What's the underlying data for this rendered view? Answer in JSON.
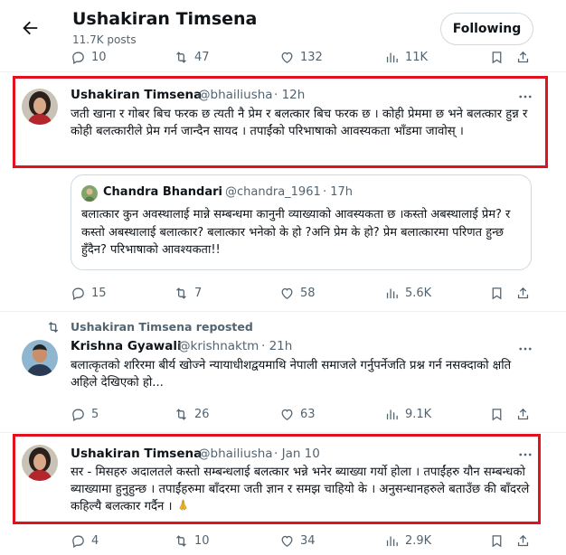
{
  "header": {
    "title": "Ushakiran Timsena",
    "post_count": "11.7K posts",
    "follow_button": "Following"
  },
  "top_actions": {
    "replies": "10",
    "reposts": "47",
    "likes": "132",
    "views": "11K"
  },
  "tweet1": {
    "name": "Ushakiran Timsena",
    "handle": "@bhailiusha",
    "time": "· 12h",
    "text": "जती खाना र गोबर बिच फरक छ त्यती नै प्रेम र बलत्कार बिच फरक छ । कोही प्रेममा छ भने बलत्कार हुन्न र कोही  बलत्कारीले प्रेम गर्न जान्दैन सायद । तपाईंको  परिभाषाको आवस्यकता भाँडमा जावोस् ।",
    "quote": {
      "name": "Chandra Bhandari",
      "handle": "@chandra_1961",
      "time": "· 17h",
      "text": "बलात्कार कुन अवस्थालाई मान्ने सम्बन्धमा कानुनी व्याख्याको आवस्यकता छ ।कस्तो अबस्थालाई प्रेम? र कस्तो अबस्थालाई बलात्कार? बलात्कार भनेको के हो ?अनि प्रेम के हो? प्रेम बलात्कारमा परिणत हुन्छ हुँदैन? परिभाषाको आवश्यकता!!"
    },
    "actions": {
      "replies": "15",
      "reposts": "7",
      "likes": "58",
      "views": "5.6K"
    }
  },
  "tweet2": {
    "repost_label": "Ushakiran Timsena reposted",
    "name": "Krishna Gyawali",
    "handle": "@krishnaktm",
    "time": "· 21h",
    "text": "बलात्कृतको शरिरमा बीर्य खोज्ने न्यायाधीशद्वयमाथि नेपाली समाजले गर्नुपर्नेजति प्रश्न गर्न नसक्दाको क्षति अहिले देखिएको हो...",
    "actions": {
      "replies": "5",
      "reposts": "26",
      "likes": "63",
      "views": "9.1K"
    }
  },
  "tweet3": {
    "name": "Ushakiran Timsena",
    "handle": "@bhailiusha",
    "time": "· Jan 10",
    "text": "सर - मिसहरु अदालतले कस्तो सम्बन्धलाई बलत्कार भन्ने भनेर ब्याख्या गर्यो होला । तपाईंहरु यौन सम्बन्धको ब्याख्यामा हुनुहुन्छ । तपाईंहरुमा बाँदरमा जती ज्ञान र समझ चाहियो के । अनुसन्धानहरुले बताउँछ की बाँदरले कहिल्यै बलत्कार गर्दैन ।",
    "emoji": "folded-hands",
    "actions": {
      "replies": "4",
      "reposts": "10",
      "likes": "34",
      "views": "2.9K"
    }
  },
  "colors": {
    "highlight": "#e3101f",
    "muted": "#536471",
    "text": "#0f1419",
    "border": "#cfd9de"
  }
}
